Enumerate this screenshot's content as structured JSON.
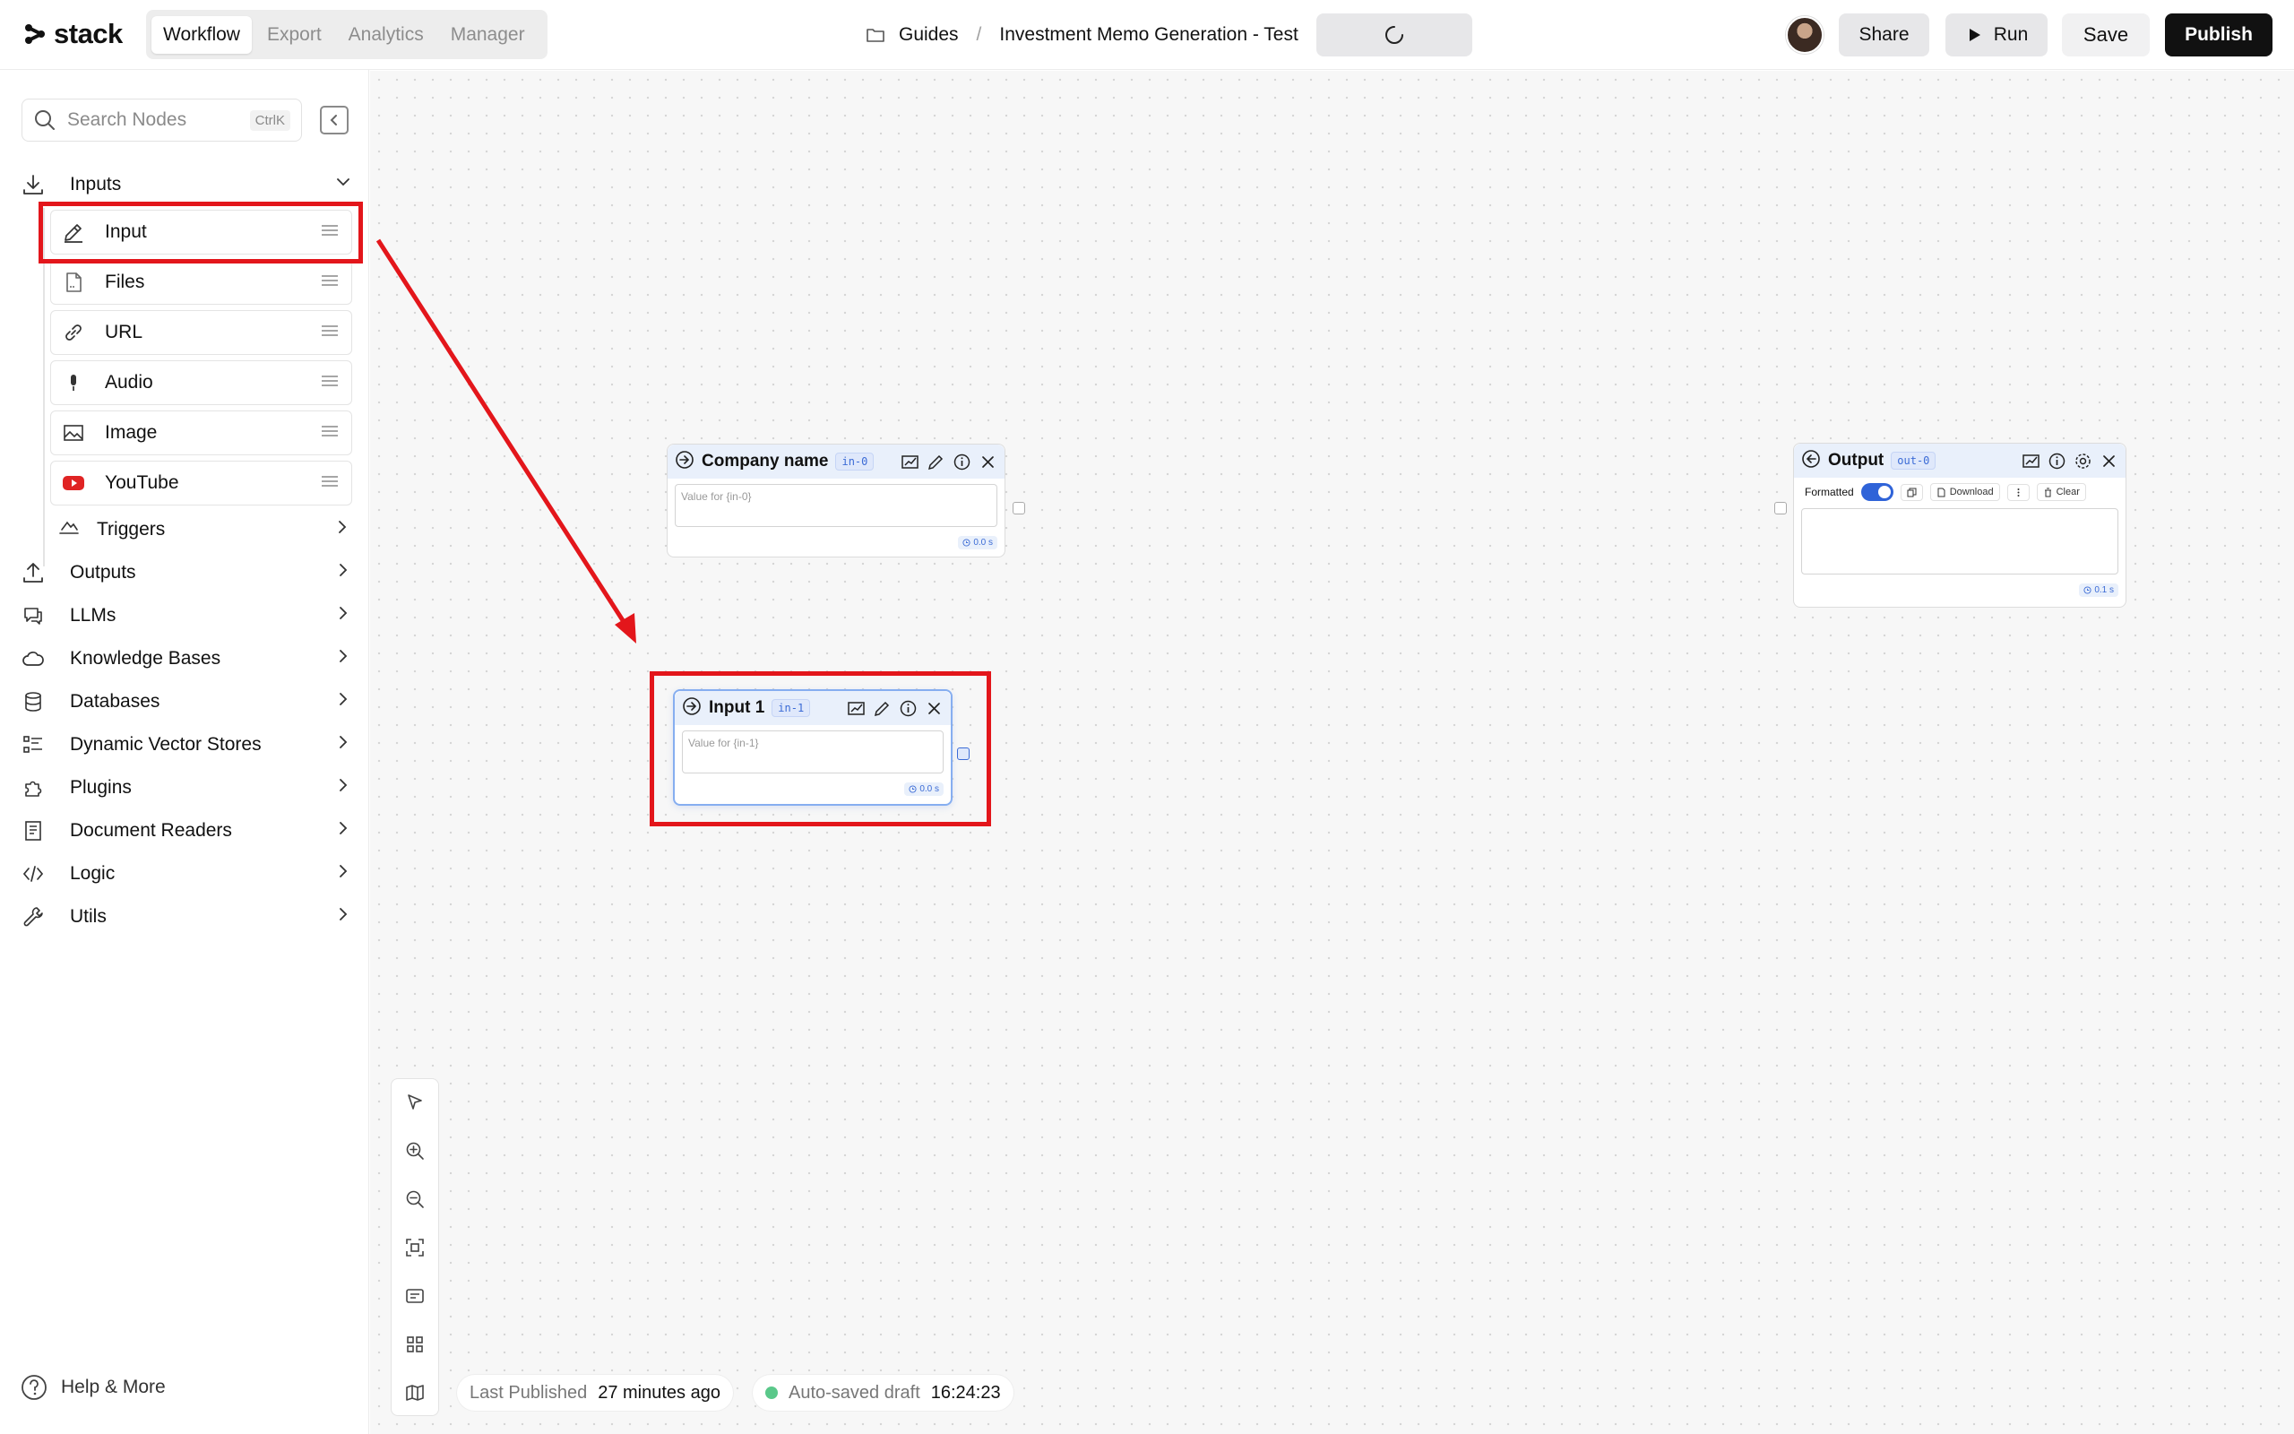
{
  "app": {
    "logo_text": "stack",
    "tabs": [
      {
        "label": "Workflow",
        "active": true
      },
      {
        "label": "Export",
        "active": false
      },
      {
        "label": "Analytics",
        "active": false
      },
      {
        "label": "Manager",
        "active": false
      }
    ]
  },
  "breadcrumb": {
    "folder": "Guides",
    "separator": "/",
    "project": "Investment Memo Generation - Test"
  },
  "header": {
    "share_label": "Share",
    "run_label": "Run",
    "save_label": "Save",
    "publish_label": "Publish",
    "accent": "#111111"
  },
  "sidebar": {
    "search_placeholder": "Search Nodes",
    "search_shortcut": "CtrlK",
    "inputs": {
      "label": "Inputs",
      "items": [
        {
          "label": "Input",
          "icon": "pencil-icon"
        },
        {
          "label": "Files",
          "icon": "file-icon"
        },
        {
          "label": "URL",
          "icon": "link-icon"
        },
        {
          "label": "Audio",
          "icon": "mic-icon"
        },
        {
          "label": "Image",
          "icon": "image-icon"
        },
        {
          "label": "YouTube",
          "icon": "youtube-icon"
        }
      ],
      "triggers_label": "Triggers"
    },
    "categories": [
      {
        "label": "Outputs",
        "icon": "upload-icon"
      },
      {
        "label": "LLMs",
        "icon": "chat-icon"
      },
      {
        "label": "Knowledge Bases",
        "icon": "cloud-icon"
      },
      {
        "label": "Databases",
        "icon": "database-icon"
      },
      {
        "label": "Dynamic Vector Stores",
        "icon": "vector-icon"
      },
      {
        "label": "Plugins",
        "icon": "puzzle-icon"
      },
      {
        "label": "Document Readers",
        "icon": "document-icon"
      },
      {
        "label": "Logic",
        "icon": "code-icon"
      },
      {
        "label": "Utils",
        "icon": "wrench-icon"
      }
    ],
    "help_label": "Help & More"
  },
  "nodes": {
    "company": {
      "title": "Company name",
      "badge": "in-0",
      "placeholder": "Value for {in-0}",
      "time": "0.0 s"
    },
    "input1": {
      "title": "Input 1",
      "badge": "in-1",
      "placeholder": "Value for {in-1}",
      "time": "0.0 s"
    },
    "output": {
      "title": "Output",
      "badge": "out-0",
      "formatted_label": "Formatted",
      "download_label": "Download",
      "clear_label": "Clear",
      "time": "0.1 s"
    }
  },
  "status": {
    "published_label": "Last Published",
    "published_value": "27 minutes ago",
    "autosave_label": "Auto-saved draft",
    "autosave_value": "16:24:23",
    "autosave_color": "#5ac88a"
  },
  "annotation_color": "#e3161b"
}
